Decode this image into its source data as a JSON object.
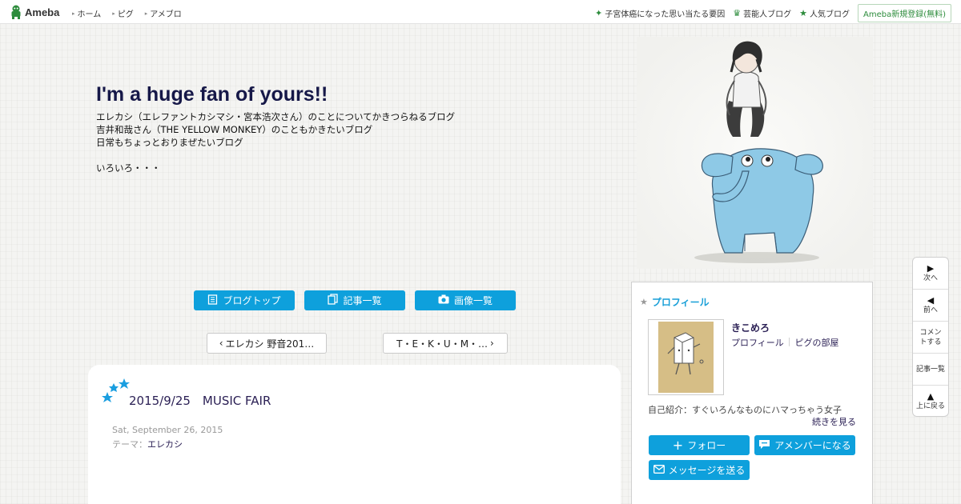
{
  "topbar": {
    "logo_text": "Ameba",
    "nav": [
      "ホーム",
      "ピグ",
      "アメブロ"
    ],
    "right_links": [
      {
        "label": "子宮体癌になった思い当たる要因",
        "icon": "sparkle-icon"
      },
      {
        "label": "芸能人ブログ",
        "icon": "crown-icon"
      },
      {
        "label": "人気ブログ",
        "icon": "star-icon"
      }
    ],
    "register_label": "Ameba新規登録(無料)"
  },
  "header": {
    "title": "I'm a huge fan of yours!!",
    "description": [
      "エレカシ（エレファントカシマシ・宮本浩次さん）のことについてかきつらねるブログ",
      "吉井和哉さん（THE YELLOW MONKEY）のこともかきたいブログ",
      "日常もちょっとおりまぜたいブログ"
    ],
    "description_extra": "いろいろ・・・"
  },
  "nav_buttons": {
    "blog_top": "ブログトップ",
    "entry_list": "記事一覧",
    "image_list": "画像一覧"
  },
  "pager": {
    "prev": "エレカシ 野音201…",
    "next": "T・E・K・U・M・…"
  },
  "article": {
    "title": "2015/9/25　MUSIC FAIR",
    "date": "Sat, September 26, 2015",
    "theme_label": "テーマ：",
    "theme_value": "エレカシ"
  },
  "profile": {
    "heading": "プロフィール",
    "name": "きこめろ",
    "link_profile": "プロフィール",
    "link_room": "ピグの部屋",
    "intro": "自己紹介：すぐいろんなものにハマっちゃう女子",
    "more": "続きを見る",
    "follow": "フォロー",
    "member": "アメンバーになる",
    "message": "メッセージを送る"
  },
  "float_nav": {
    "next": "次へ",
    "prev": "前へ",
    "comment": "コメントする",
    "entries": "記事一覧",
    "top": "上に戻る"
  },
  "colors": {
    "accent_blue": "#0ea0dc",
    "title_navy": "#161848",
    "ameba_green": "#2d8c3c"
  }
}
